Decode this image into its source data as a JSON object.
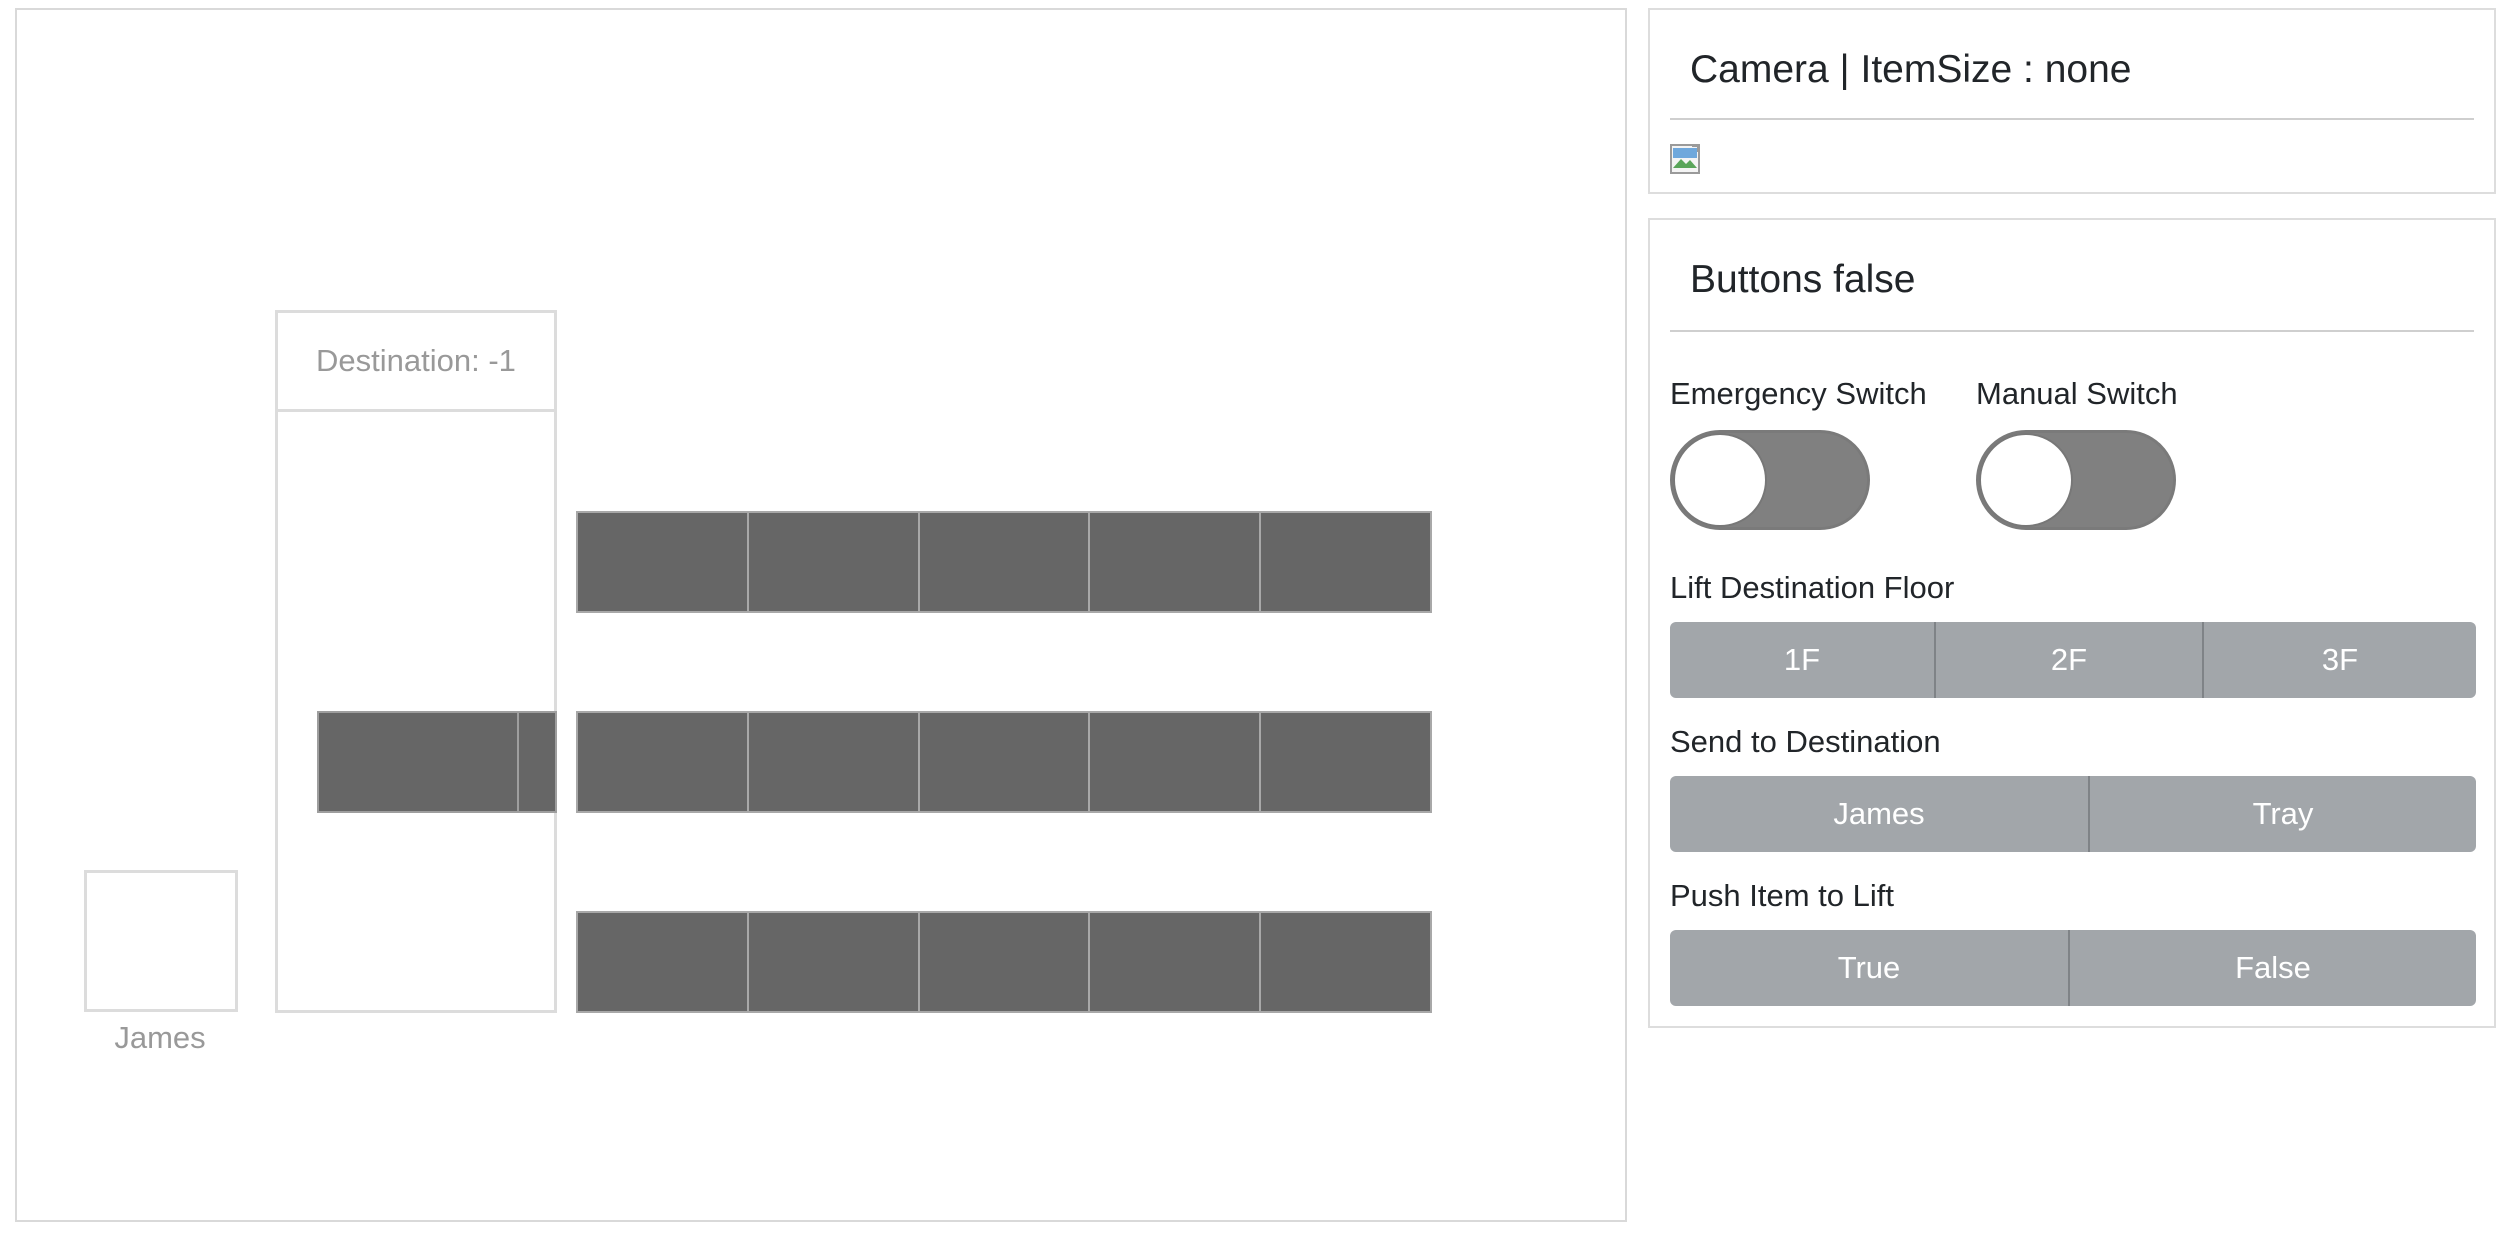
{
  "simulation": {
    "lift_header": "Destination: -1",
    "person_label": "James"
  },
  "camera_panel": {
    "title": "Camera | ItemSize : none",
    "image_alt": "broken-image"
  },
  "buttons_panel": {
    "title": "Buttons false",
    "emergency_switch_label": "Emergency Switch",
    "manual_switch_label": "Manual Switch",
    "lift_floor_label": "Lift Destination Floor",
    "floors": [
      "1F",
      "2F",
      "3F"
    ],
    "send_label": "Send to Destination",
    "destinations": [
      "James",
      "Tray"
    ],
    "push_label": "Push Item to Lift",
    "push_options": [
      "True",
      "False"
    ]
  },
  "colors": {
    "item_fill": "#666666",
    "button_bg": "#a2a6aa",
    "toggle_off": "#808080"
  }
}
